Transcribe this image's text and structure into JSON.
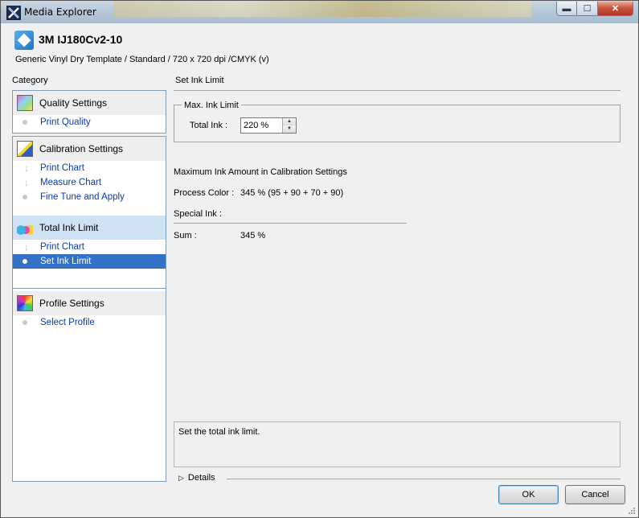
{
  "window": {
    "title": "Media Explorer",
    "minimize": "▬",
    "maximize": "☐",
    "close": "✕"
  },
  "header": {
    "media_name": "3M IJ180Cv2-10",
    "media_description": "Generic Vinyl Dry Template / Standard / 720 x 720 dpi /CMYK (v)"
  },
  "sidebar": {
    "category_label": "Category",
    "groups": [
      {
        "title": "Quality Settings",
        "items": [
          "Print Quality"
        ]
      },
      {
        "title": "Calibration Settings",
        "items": [
          "Print Chart",
          "Measure Chart",
          "Fine Tune and Apply"
        ]
      },
      {
        "title": "Total Ink Limit",
        "items": [
          "Print Chart",
          "Set Ink Limit"
        ]
      },
      {
        "title": "Profile Settings",
        "items": [
          "Select Profile"
        ]
      }
    ]
  },
  "main": {
    "section_title": "Set Ink Limit",
    "max_ink_group": "Max. Ink Limit",
    "total_ink_label": "Total Ink :",
    "total_ink_value": "220 %",
    "max_ink_heading": "Maximum Ink Amount in Calibration Settings",
    "process_color_label": "Process Color :",
    "process_color_value": "345 % (95 + 90 + 70 + 90)",
    "special_ink_label": "Special Ink :",
    "sum_label": "Sum :",
    "sum_value": "345 %",
    "description": "Set the total ink limit.",
    "details_label": "Details"
  },
  "buttons": {
    "ok": "OK",
    "cancel": "Cancel"
  }
}
